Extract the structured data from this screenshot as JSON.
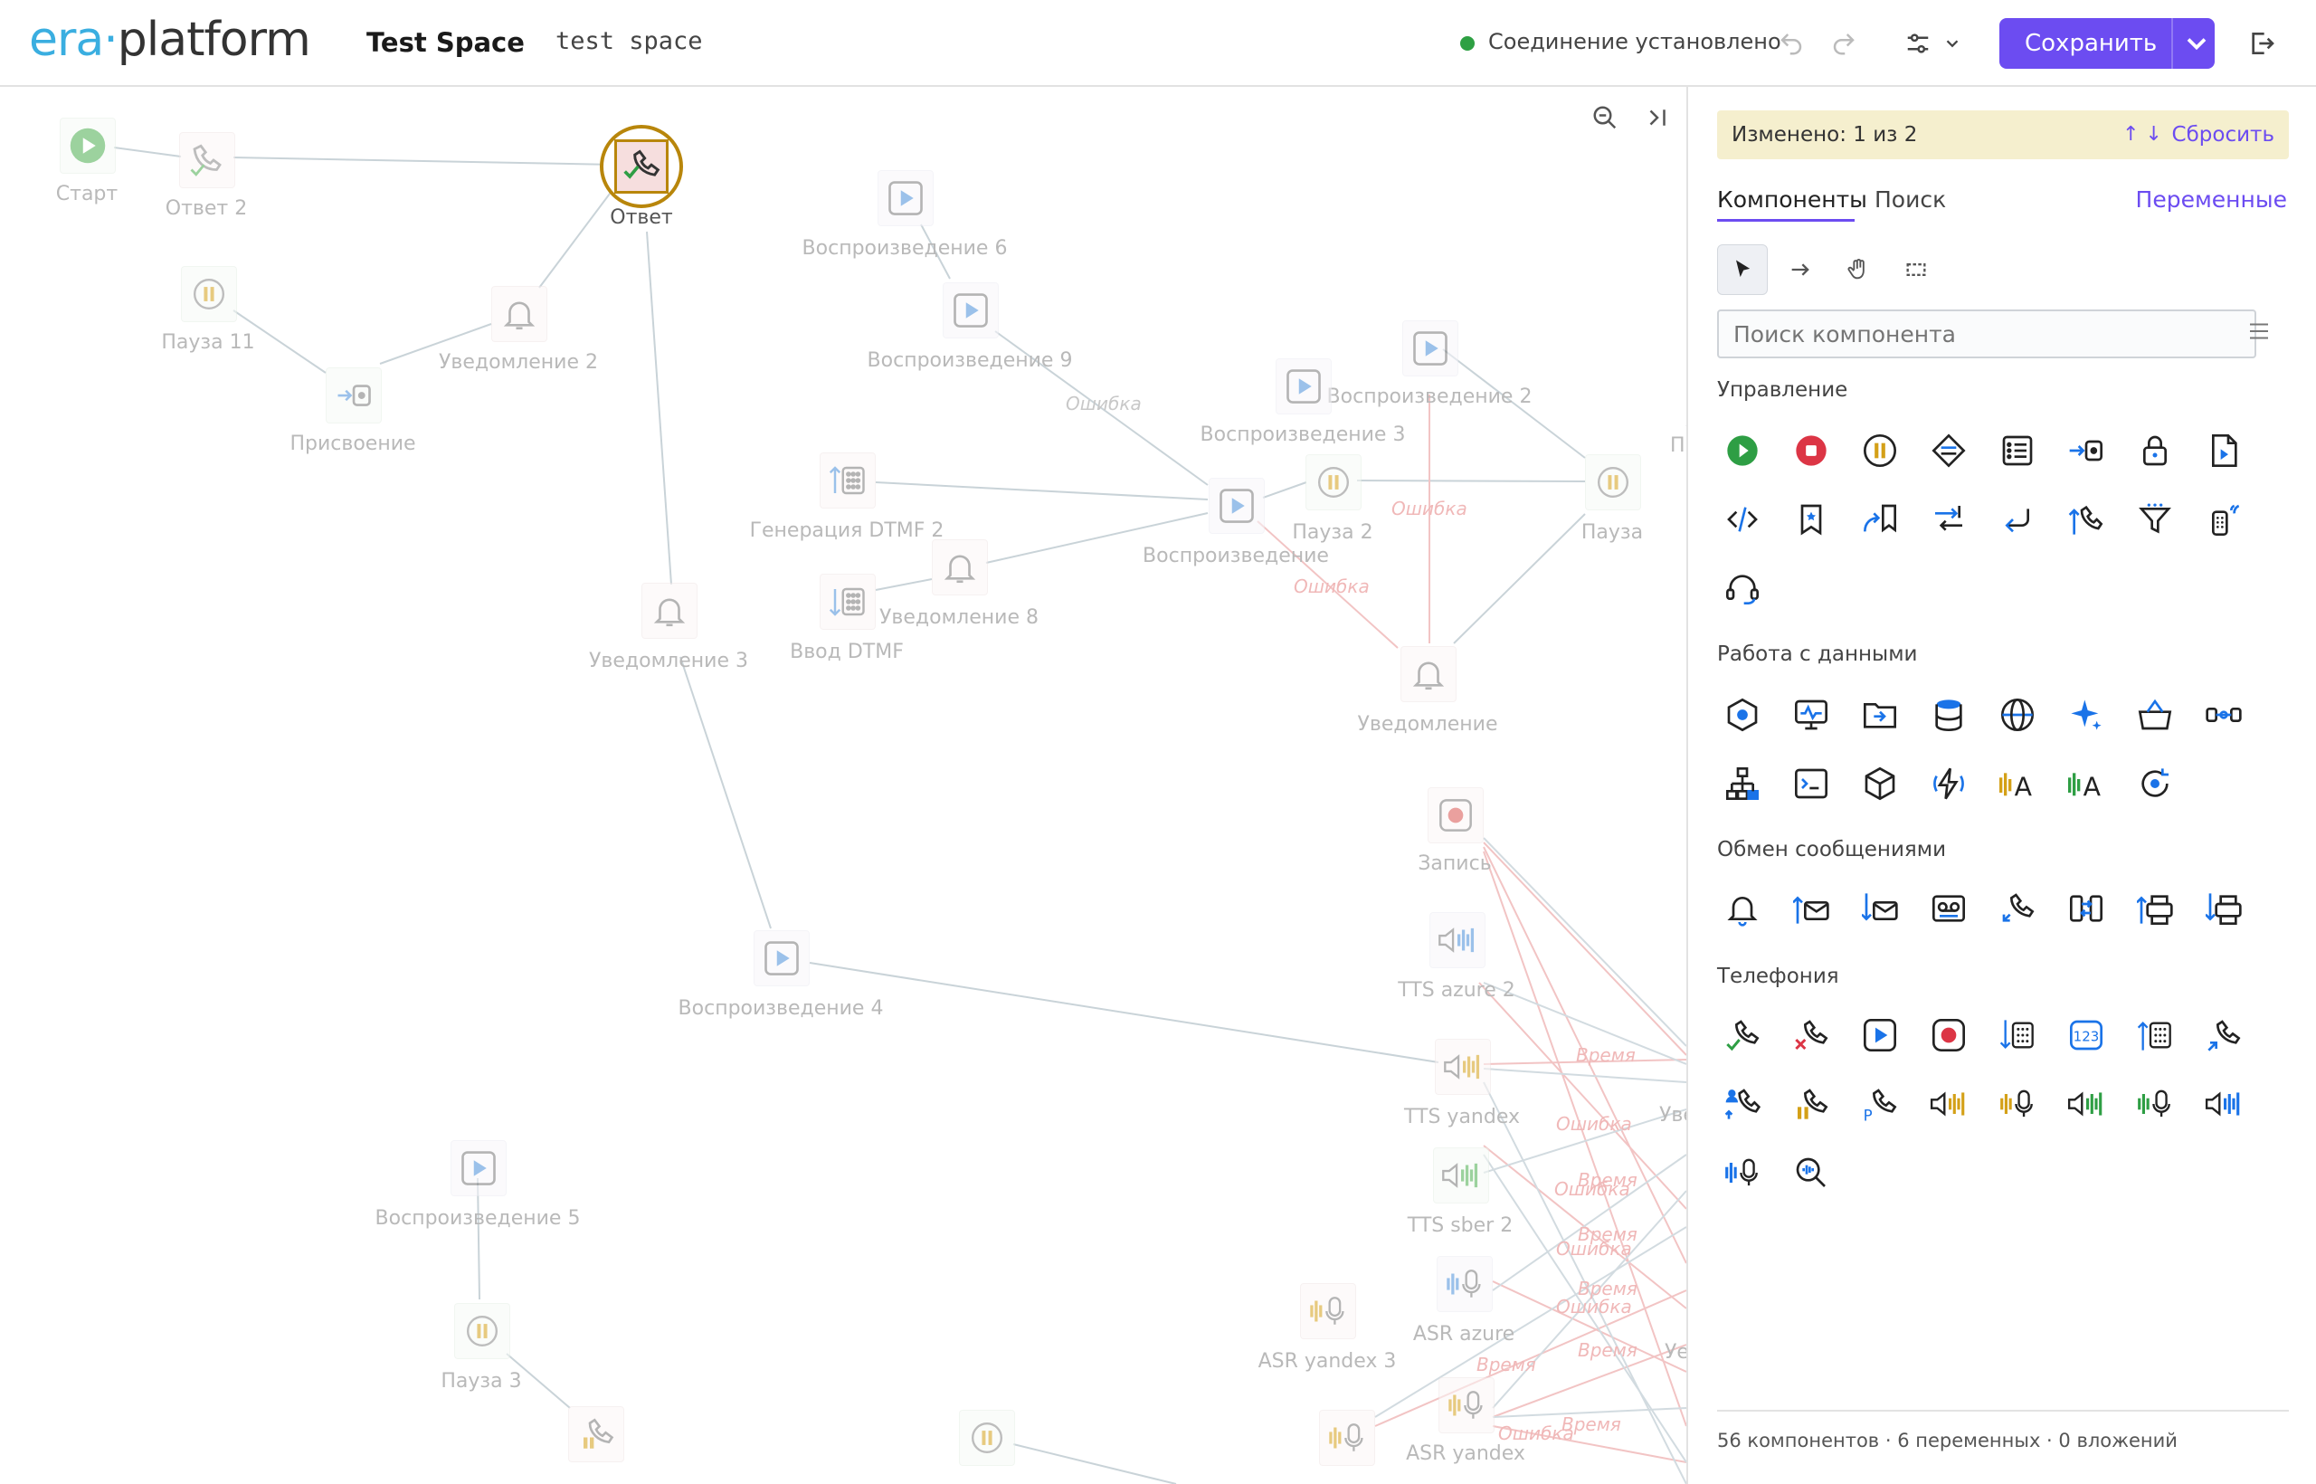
{
  "header": {
    "logo_era": "era",
    "logo_dot": "·",
    "logo_platform": "platform",
    "space_title": "Test Space",
    "space_subtitle": "test space",
    "status_text": "Соединение установлено",
    "status_color": "#2ea043",
    "save_label": "Сохранить",
    "accent_color": "#6c4cf1",
    "icons": [
      "undo-icon",
      "redo-icon",
      "settings-sliders-icon",
      "chevron-down-icon",
      "logout-icon"
    ]
  },
  "canvas": {
    "nodes": [
      {
        "label": "Старт",
        "icon": "play-icon"
      },
      {
        "label": "Ответ 2",
        "icon": "phone-answer-icon"
      },
      {
        "label": "Ответ",
        "icon": "phone-answer-icon",
        "selected": true
      },
      {
        "label": "Пауза 11",
        "icon": "pause-icon"
      },
      {
        "label": "Уведомление 2",
        "icon": "bell-icon"
      },
      {
        "label": "Присвоение",
        "icon": "assign-icon"
      },
      {
        "label": "Воспроизведение 6",
        "icon": "play-media-icon"
      },
      {
        "label": "Воспроизведение 9",
        "icon": "play-media-icon"
      },
      {
        "label": "Воспроизведение 2",
        "icon": "play-media-icon"
      },
      {
        "label": "Воспроизведение 3",
        "icon": "play-media-icon"
      },
      {
        "label": "Генерация DTMF 2",
        "icon": "dtmf-generate-icon"
      },
      {
        "label": "Воспроизведение",
        "icon": "play-media-icon"
      },
      {
        "label": "Пауза 2",
        "icon": "pause-icon"
      },
      {
        "label": "Пауза",
        "icon": "pause-icon"
      },
      {
        "label": "Уведомление 8",
        "icon": "bell-icon"
      },
      {
        "label": "Ввод DTMF",
        "icon": "dtmf-input-icon"
      },
      {
        "label": "Уведомление 3",
        "icon": "bell-icon"
      },
      {
        "label": "Уведомление",
        "icon": "bell-icon"
      },
      {
        "label": "Запись",
        "icon": "record-icon"
      },
      {
        "label": "TTS azure 2",
        "icon": "tts-icon"
      },
      {
        "label": "Воспроизведение 4",
        "icon": "play-media-icon"
      },
      {
        "label": "TTS yandex",
        "icon": "tts-icon"
      },
      {
        "label": "Воспроизведение 5",
        "icon": "play-media-icon"
      },
      {
        "label": "TTS sber 2",
        "icon": "tts-icon"
      },
      {
        "label": "ASR azure",
        "icon": "asr-icon"
      },
      {
        "label": "ASR yandex 3",
        "icon": "asr-icon"
      },
      {
        "label": "Пауза 3",
        "icon": "pause-icon"
      },
      {
        "label": "ASR yandex",
        "icon": "asr-icon"
      }
    ],
    "edge_labels": [
      "Ошибка",
      "Ошибка",
      "Ошибка",
      "Время",
      "Ошибка",
      "Время",
      "Ошибка",
      "Время",
      "Ошибка",
      "Время",
      "Ошибка",
      "Время",
      "Время",
      "Ошибка",
      "Время"
    ],
    "partial_labels": [
      "Увед",
      "Уе",
      "П"
    ],
    "tools": [
      "zoom-out-icon",
      "collapse-panel-icon"
    ]
  },
  "panel": {
    "changed_text": "Изменено: 1 из 2",
    "arrows": "↑ ↓",
    "reset_label": "Сбросить",
    "tabs": [
      {
        "label": "Компоненты",
        "active": true
      },
      {
        "label": "Поиск",
        "active": false
      }
    ],
    "variables_label": "Переменные",
    "tools": [
      "pointer-icon",
      "arrow-connect-icon",
      "hand-icon",
      "marquee-select-icon"
    ],
    "search_placeholder": "Поиск компонента",
    "sections": [
      {
        "title": "Управление",
        "icons": [
          "start-icon",
          "stop-icon",
          "pause-icon",
          "condition-icon",
          "list-icon",
          "assign-icon",
          "lock-icon",
          "script-file-icon",
          "code-icon",
          "bookmark-icon",
          "goto-bookmark-icon",
          "transfer-icon",
          "return-icon",
          "call-out-icon",
          "filter-icon",
          "remote-icon",
          "headset-icon"
        ]
      },
      {
        "title": "Работа с данными",
        "icons": [
          "hexagon-icon",
          "monitor-icon",
          "folder-icon",
          "database-icon",
          "globe-icon",
          "sparkle-icon",
          "basket-icon",
          "link-icon",
          "hierarchy-icon",
          "terminal-icon",
          "cube-icon",
          "lightning-icon",
          "tts-yellow-icon",
          "tts-green-icon",
          "refresh-target-icon"
        ]
      },
      {
        "title": "Обмен сообщениями",
        "icons": [
          "bell-icon",
          "mail-send-icon",
          "mail-receive-icon",
          "voicemail-icon",
          "call-back-icon",
          "sync-icon",
          "fax-send-icon",
          "fax-receive-icon"
        ]
      },
      {
        "title": "Телефония",
        "icons": [
          "answer-icon",
          "hangup-icon",
          "play-icon",
          "record-icon",
          "dtmf-input-icon",
          "digits-icon",
          "dtmf-generate-icon",
          "redirect-icon",
          "user-transfer-icon",
          "hold-icon",
          "park-icon",
          "tts-yandex-icon",
          "asr-yandex-icon",
          "tts-green-icon",
          "asr-green-icon",
          "tts-blue-icon",
          "asr-blue-icon",
          "search-audio-icon"
        ]
      }
    ],
    "footer": "56 компонентов · 6 переменных · 0 вложений"
  }
}
